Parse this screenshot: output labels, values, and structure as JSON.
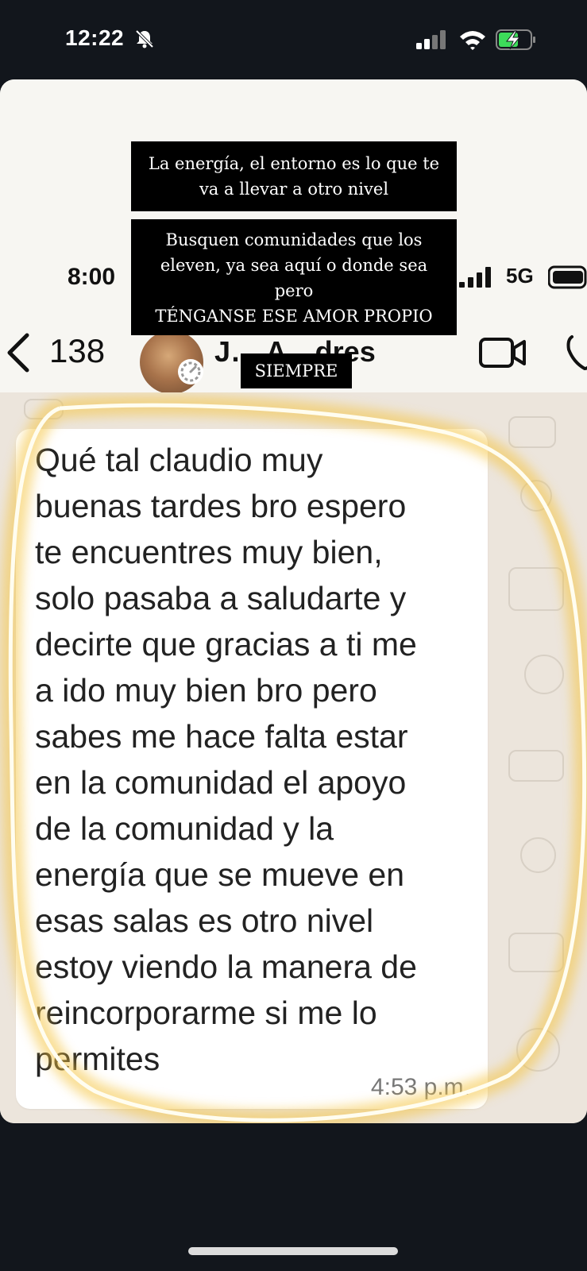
{
  "status_bar": {
    "time": "12:22",
    "icons": [
      "bell-slash-icon",
      "cellular-signal-icon",
      "wifi-icon",
      "battery-charging-icon"
    ]
  },
  "inner_status_bar": {
    "time": "8:00",
    "network": "5G"
  },
  "chat_header": {
    "back_count": "138",
    "contact_name_visible": "J… A…dres",
    "icons": [
      "back-arrow-icon",
      "video-call-icon",
      "phone-icon"
    ]
  },
  "captions": {
    "line1": "La energía, el entorno es lo que te",
    "line2": "va a llevar a otro nivel",
    "line3": "Busquen comunidades que los",
    "line4": "eleven, ya sea aquí o donde sea",
    "line5": "pero",
    "line6": "TÉNGANSE ESE AMOR PROPIO",
    "line7": "SIEMPRE"
  },
  "message": {
    "lines": [
      "Qué tal claudio muy",
      "buenas tardes bro espero",
      "te encuentres muy bien,",
      "solo pasaba a saludarte y",
      "decirte que gracias a ti me",
      "a ido muy bien bro pero",
      "sabes me hace falta estar",
      "en la comunidad el apoyo",
      "de la comunidad y la",
      "energía que se mueve en",
      "esas salas es otro nivel",
      "estoy viendo la manera de",
      "reincorporarme si me lo",
      "permites"
    ],
    "time": "4:53 p.m."
  },
  "colors": {
    "highlight": "#f5c542",
    "caption_bg": "#000000",
    "chat_bg": "#ece5dc"
  }
}
